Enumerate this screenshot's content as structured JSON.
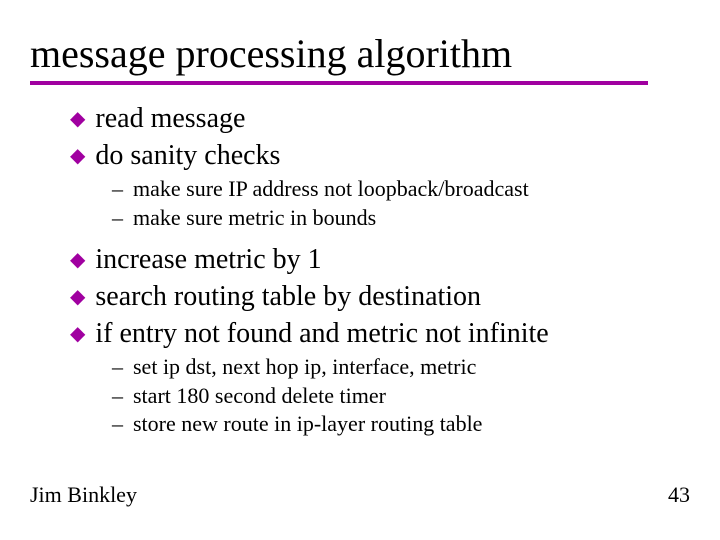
{
  "title": "message processing algorithm",
  "bullets": {
    "b1": "read message",
    "b2": "do sanity checks",
    "b2a": "make sure IP address not loopback/broadcast",
    "b2b": "make sure metric in bounds",
    "b3": "increase metric by 1",
    "b4": "search routing table by destination",
    "b5": "if entry not found and metric not infinite",
    "b5a": "set ip dst, next hop ip, interface, metric",
    "b5b": "start 180 second delete timer",
    "b5c": "store new route in ip-layer routing table"
  },
  "footer": {
    "author": "Jim Binkley",
    "page": "43"
  },
  "glyph": {
    "diamond": "◆",
    "dash": "–"
  }
}
